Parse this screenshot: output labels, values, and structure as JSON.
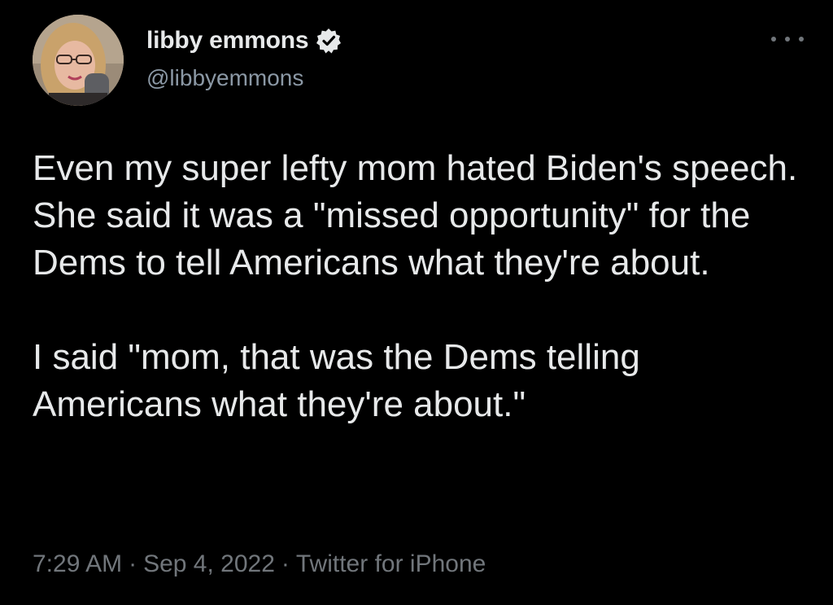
{
  "author": {
    "display_name": "libby emmons",
    "handle": "@libbyemmons",
    "verified": true,
    "avatar": "profile-photo"
  },
  "tweet": {
    "paragraphs": [
      "Even my super lefty mom hated Biden's speech. She said it was a \"missed opportunity\" for the Dems to tell Americans what they're about.",
      "I said \"mom, that was the Dems telling Americans what they're about.\""
    ],
    "time": "7:29 AM",
    "separator": "·",
    "date": "Sep 4, 2022",
    "source": "Twitter for iPhone"
  },
  "icons": {
    "verified": "verified-badge-icon",
    "more": "more-options-icon"
  },
  "colors": {
    "background": "#000000",
    "text": "#e7e9ea",
    "secondary_text": "#71767b"
  }
}
